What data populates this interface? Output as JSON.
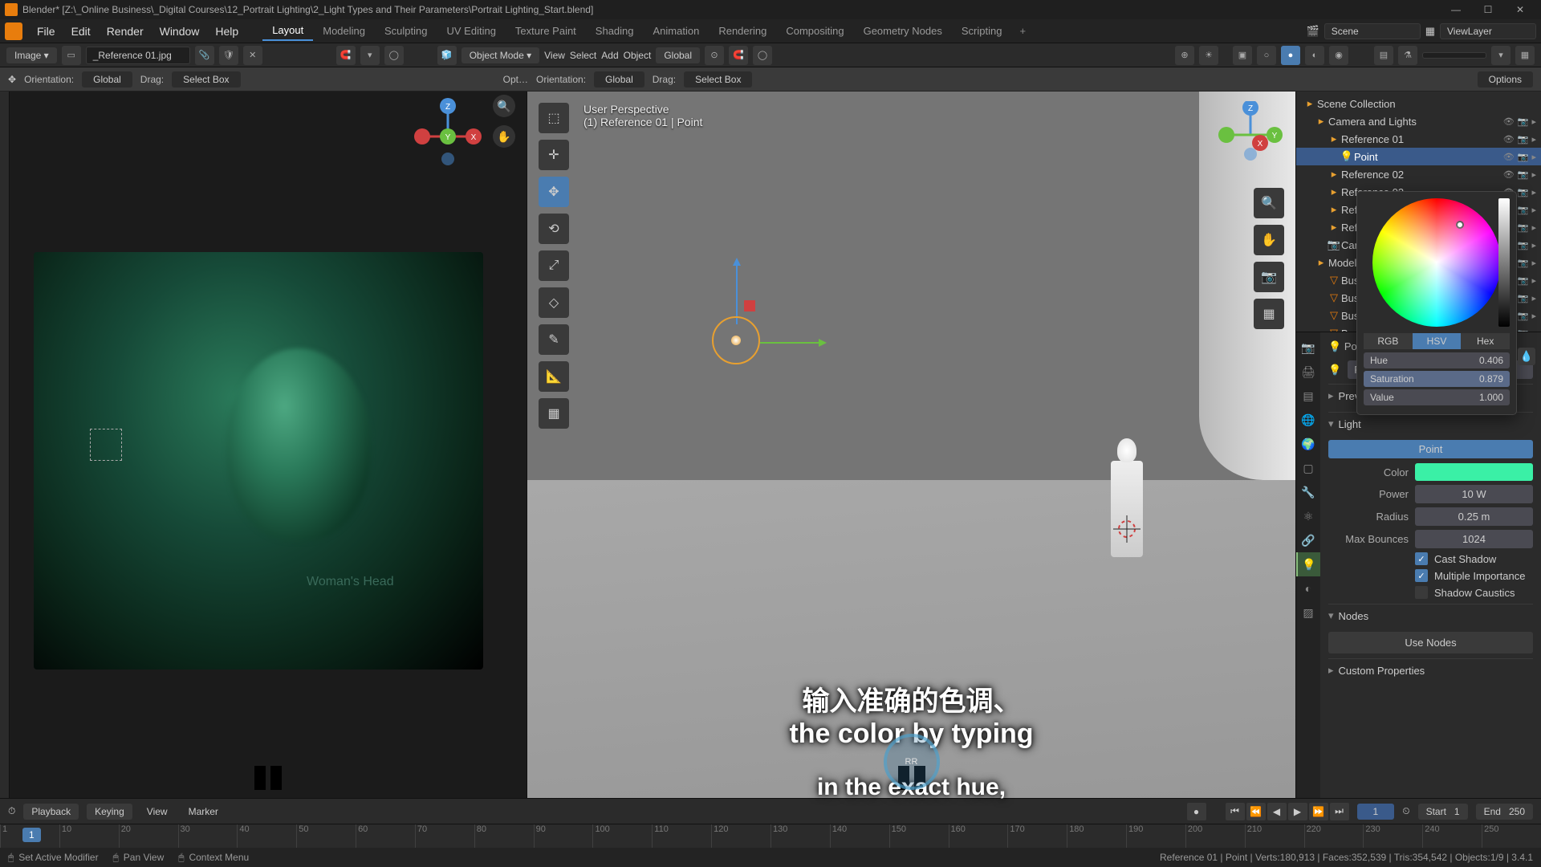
{
  "title": "Blender* [Z:\\_Online Business\\_Digital Courses\\12_Portrait Lighting\\2_Light Types and Their Parameters\\Portrait Lighting_Start.blend]",
  "menus": [
    "File",
    "Edit",
    "Render",
    "Window",
    "Help"
  ],
  "workspaces": [
    "Layout",
    "Modeling",
    "Sculpting",
    "UV Editing",
    "Texture Paint",
    "Shading",
    "Animation",
    "Rendering",
    "Compositing",
    "Geometry Nodes",
    "Scripting"
  ],
  "active_workspace": "Layout",
  "header_right": {
    "scene_label": "Scene",
    "viewlayer_label": "ViewLayer"
  },
  "image_slot": "_Reference 01.jpg",
  "viewport_menus3d": [
    "View",
    "Select",
    "Add",
    "Object"
  ],
  "orientation": {
    "label": "Orientation:",
    "value": "Global",
    "drag_label": "Drag:",
    "drag_value": "Select Box",
    "options": "Options"
  },
  "transform_mode": "Global",
  "hud": {
    "line1": "User Perspective",
    "line2": "(1) Reference 01 | Point"
  },
  "portrait_title": "Woman's Head",
  "subtitles": {
    "cn": "输入准确的色调、",
    "en1": "the color by typing",
    "en2": "in the exact hue,"
  },
  "outliner": {
    "root": "Scene Collection",
    "items": [
      {
        "name": "Camera and Lights",
        "type": "coll",
        "depth": 1
      },
      {
        "name": "Reference 01",
        "type": "coll",
        "depth": 2
      },
      {
        "name": "Point",
        "type": "light",
        "depth": 3,
        "sel": true
      },
      {
        "name": "Reference 02",
        "type": "coll",
        "depth": 2
      },
      {
        "name": "Reference 03",
        "type": "coll",
        "depth": 2
      },
      {
        "name": "Reference 04",
        "type": "coll",
        "depth": 2
      },
      {
        "name": "Reference 05",
        "type": "coll",
        "depth": 2
      },
      {
        "name": "Camera",
        "type": "cam",
        "depth": 2
      },
      {
        "name": "Models",
        "type": "coll",
        "depth": 1
      },
      {
        "name": "Bust -",
        "type": "mesh",
        "depth": 2
      },
      {
        "name": "Bust -",
        "type": "mesh",
        "depth": 2
      },
      {
        "name": "Bust -",
        "type": "mesh",
        "depth": 2
      },
      {
        "name": "Bust -",
        "type": "mesh",
        "depth": 2
      }
    ]
  },
  "props": {
    "crumb_obj": "Point",
    "crumb_data": "Point",
    "panels": {
      "preview": "Preview",
      "light": "Light",
      "nodes": "Nodes",
      "custom": "Custom Properties"
    },
    "light_type": "Point",
    "color_label": "Color",
    "color": "#3af0a6",
    "power_label": "Power",
    "power": "10 W",
    "radius_label": "Radius",
    "radius": "0.25 m",
    "maxb_label": "Max Bounces",
    "maxb": "1024",
    "cast": "Cast Shadow",
    "mis": "Multiple Importance",
    "caustics": "Shadow Caustics",
    "use_nodes": "Use Nodes"
  },
  "colorpicker": {
    "modes": [
      "RGB",
      "HSV",
      "Hex"
    ],
    "active": "HSV",
    "hue_label": "Hue",
    "hue": "0.406",
    "sat_label": "Saturation",
    "sat": "0.879",
    "val_label": "Value",
    "val": "1.000"
  },
  "timeline": {
    "playback": "Playback",
    "keying": "Keying",
    "view": "View",
    "marker": "Marker",
    "cur": "1",
    "start_label": "Start",
    "start": "1",
    "end_label": "End",
    "end": "250",
    "ticks": [
      "1",
      "10",
      "20",
      "30",
      "40",
      "50",
      "60",
      "70",
      "80",
      "90",
      "100",
      "110",
      "120",
      "130",
      "140",
      "150",
      "160",
      "170",
      "180",
      "190",
      "200",
      "210",
      "220",
      "230",
      "240",
      "250"
    ]
  },
  "status": {
    "action": "Set Active Modifier",
    "pan": "Pan View",
    "ctx": "Context Menu",
    "stats": "Reference 01 | Point   | Verts:180,913 | Faces:352,539 | Tris:354,542 | Objects:1/9 | 3.4.1"
  }
}
